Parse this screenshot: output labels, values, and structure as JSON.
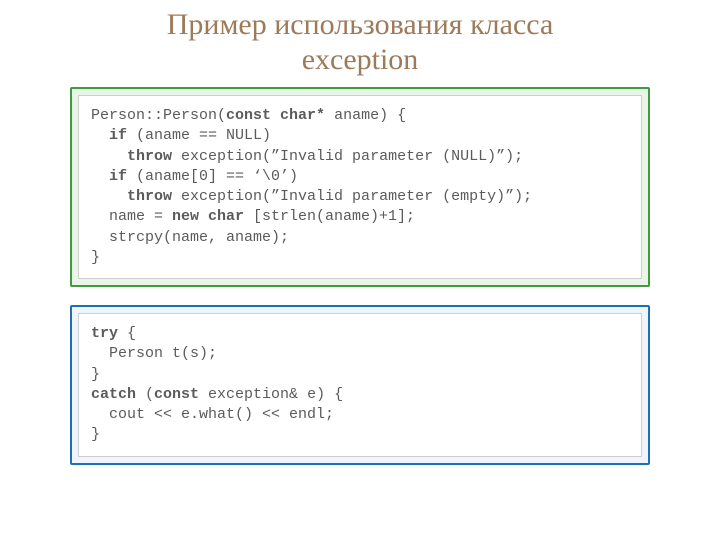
{
  "title_line1": "Пример использования класса",
  "title_line2": "exception",
  "code1": {
    "l1a": "Person::Person(",
    "l1b": "const char*",
    "l1c": " aname) {",
    "l2a": "  ",
    "l2b": "if",
    "l2c": " (aname == NULL)",
    "l3a": "    ",
    "l3b": "throw",
    "l3c": " exception(”Invalid parameter (NULL)”);",
    "l4a": "  ",
    "l4b": "if",
    "l4c": " (aname[0] == ‘\\0’)",
    "l5a": "    ",
    "l5b": "throw",
    "l5c": " exception(”Invalid parameter (empty)”);",
    "l6a": "  name = ",
    "l6b": "new char",
    "l6c": " [strlen(aname)+1];",
    "l7": "  strcpy(name, aname);",
    "l8": "}"
  },
  "code2": {
    "l1a": "try",
    "l1b": " {",
    "l2": "  Person t(s);",
    "l3": "}",
    "l4a": "catch",
    "l4b": " (",
    "l4c": "const",
    "l4d": " exception& e) {",
    "l5": "  cout << e.what() << endl;",
    "l6": "}"
  }
}
